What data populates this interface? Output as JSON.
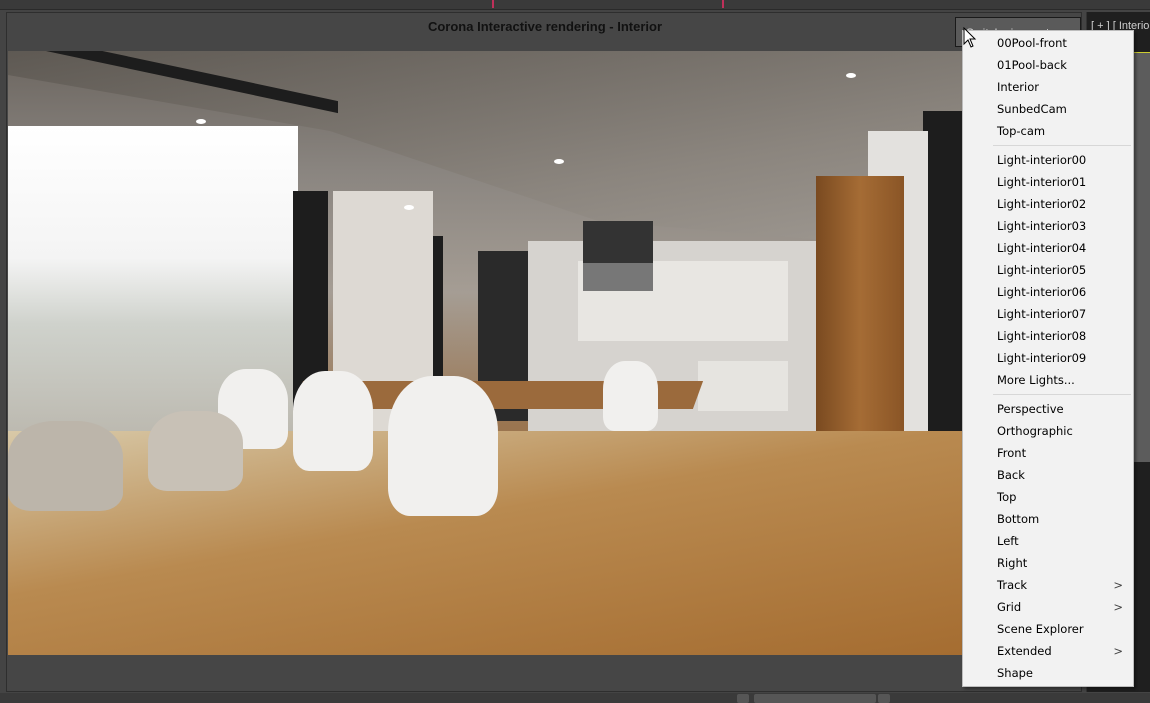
{
  "window": {
    "title": "Corona Interactive rendering - Interior",
    "switch_button": "Switch viewport"
  },
  "right_viewport": {
    "label": "[ + ] [ Interior"
  },
  "menu": {
    "groups": [
      [
        {
          "label": "00Pool-front"
        },
        {
          "label": "01Pool-back"
        },
        {
          "label": "Interior"
        },
        {
          "label": "SunbedCam"
        },
        {
          "label": "Top-cam"
        }
      ],
      [
        {
          "label": "Light-interior00"
        },
        {
          "label": "Light-interior01"
        },
        {
          "label": "Light-interior02"
        },
        {
          "label": "Light-interior03"
        },
        {
          "label": "Light-interior04"
        },
        {
          "label": "Light-interior05"
        },
        {
          "label": "Light-interior06"
        },
        {
          "label": "Light-interior07"
        },
        {
          "label": "Light-interior08"
        },
        {
          "label": "Light-interior09"
        },
        {
          "label": "More Lights..."
        }
      ],
      [
        {
          "label": "Perspective"
        },
        {
          "label": "Orthographic"
        },
        {
          "label": "Front"
        },
        {
          "label": "Back"
        },
        {
          "label": "Top"
        },
        {
          "label": "Bottom"
        },
        {
          "label": "Left"
        },
        {
          "label": "Right"
        },
        {
          "label": "Track",
          "submenu": true
        },
        {
          "label": "Grid",
          "submenu": true
        },
        {
          "label": "Scene Explorer"
        },
        {
          "label": "Extended",
          "submenu": true
        },
        {
          "label": "Shape"
        }
      ]
    ],
    "submenu_glyph": ">"
  },
  "colors": {
    "accent_marks": "#c0305a",
    "viewport_border": "#cccc30"
  }
}
